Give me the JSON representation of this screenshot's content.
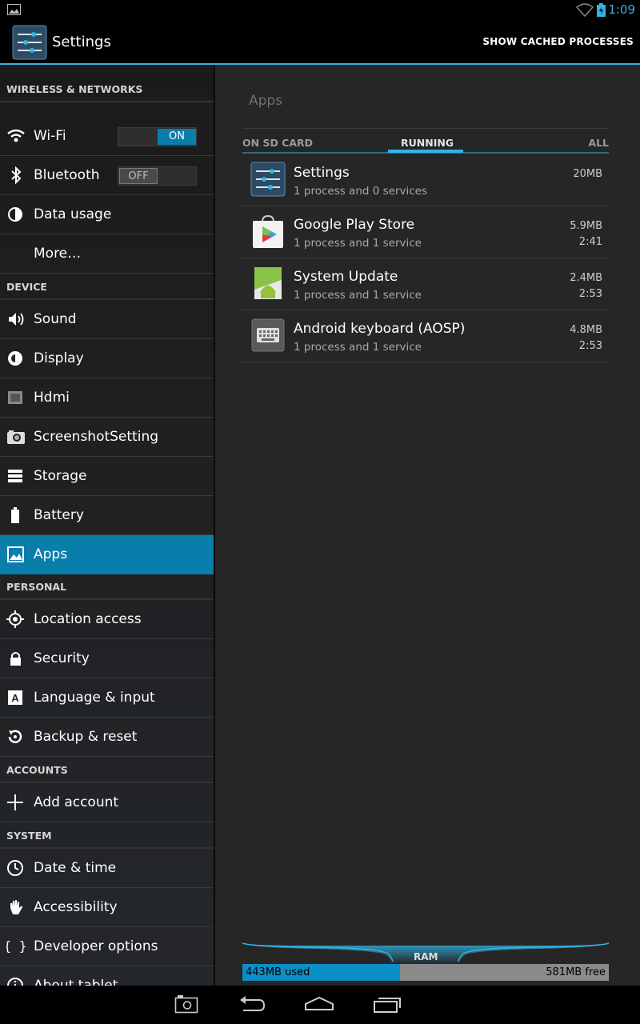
{
  "status_bar": {
    "time": "1:09"
  },
  "action_bar": {
    "title": "Settings",
    "action": "SHOW CACHED PROCESSES"
  },
  "sidebar": {
    "sections": {
      "wireless": "WIRELESS & NETWORKS",
      "device": "DEVICE",
      "personal": "PERSONAL",
      "accounts": "ACCOUNTS",
      "system": "SYSTEM"
    },
    "items": {
      "wifi": "Wi-Fi",
      "bluetooth": "Bluetooth",
      "data_usage": "Data usage",
      "more": "More…",
      "sound": "Sound",
      "display": "Display",
      "hdmi": "Hdmi",
      "screenshot": "ScreenshotSetting",
      "storage": "Storage",
      "battery": "Battery",
      "apps": "Apps",
      "location": "Location access",
      "security": "Security",
      "language": "Language & input",
      "backup": "Backup & reset",
      "add_account": "Add account",
      "date_time": "Date & time",
      "accessibility": "Accessibility",
      "developer": "Developer options",
      "about": "About tablet"
    },
    "wifi_toggle": "ON",
    "bluetooth_toggle": "OFF"
  },
  "main": {
    "title": "Apps",
    "tabs": {
      "sd_card": "ON SD CARD",
      "running": "RUNNING",
      "all": "ALL"
    },
    "processes": [
      {
        "name": "Settings",
        "desc": "1 process and 0 services",
        "size": "20MB",
        "time": ""
      },
      {
        "name": "Google Play Store",
        "desc": "1 process and 1 service",
        "size": "5.9MB",
        "time": "2:41"
      },
      {
        "name": "System Update",
        "desc": "1 process and 1 service",
        "size": "2.4MB",
        "time": "2:53"
      },
      {
        "name": "Android keyboard (AOSP)",
        "desc": "1 process and 1 service",
        "size": "4.8MB",
        "time": "2:53"
      }
    ],
    "ram": {
      "label": "RAM",
      "used": "443MB used",
      "free": "581MB free",
      "used_fraction": 0.43
    }
  },
  "colors": {
    "accent": "#33b5e5",
    "selected": "#0a7eab"
  }
}
